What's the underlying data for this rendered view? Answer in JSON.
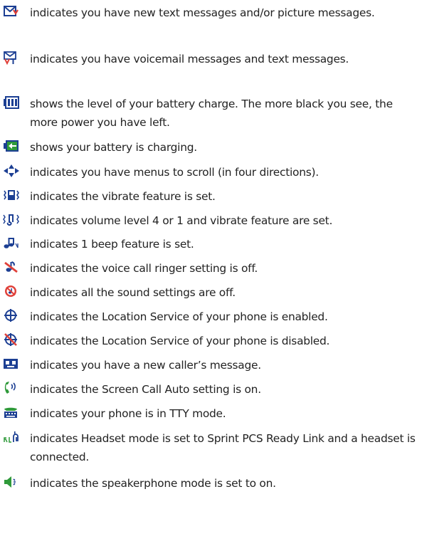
{
  "colors": {
    "text": "#222222",
    "icon_blue": "#1c3f93",
    "icon_red": "#e0413a",
    "icon_green": "#2f9a3a",
    "icon_black": "#111111"
  },
  "entries": [
    {
      "icon": "text-message-envelope-icon",
      "text": "indicates you have new text messages and/or picture messages."
    },
    {
      "icon": "voicemail-text-icon",
      "text": "indicates you have voicemail messages and text messages."
    },
    {
      "icon": "battery-level-icon",
      "text": "shows the level of your battery charge. The more black you see, the more power you have left."
    },
    {
      "icon": "battery-charging-icon",
      "text": "shows your battery is charging."
    },
    {
      "icon": "four-way-scroll-icon",
      "text": "indicates you have menus to scroll (in four directions)."
    },
    {
      "icon": "vibrate-icon",
      "text": "indicates the vibrate feature is set."
    },
    {
      "icon": "volume-vibrate-icon",
      "text": "indicates volume level 4 or 1 and vibrate feature are set."
    },
    {
      "icon": "one-beep-icon",
      "text": "indicates 1 beep feature is set."
    },
    {
      "icon": "ringer-off-icon",
      "text": "indicates the voice call ringer setting is off."
    },
    {
      "icon": "all-sounds-off-icon",
      "text": "indicates all the sound settings are off."
    },
    {
      "icon": "location-on-icon",
      "text": "indicates the Location Service of your phone is enabled."
    },
    {
      "icon": "location-off-icon",
      "text": "indicates the Location Service of your phone is disabled."
    },
    {
      "icon": "caller-message-icon",
      "text": "indicates you have a new caller’s message."
    },
    {
      "icon": "screen-call-auto-icon",
      "text": "indicates the Screen Call Auto setting is on."
    },
    {
      "icon": "tty-mode-icon",
      "text": "indicates your phone is in TTY mode."
    },
    {
      "icon": "ready-link-headset-icon",
      "text": "indicates Headset mode is set to Sprint PCS Ready Link and a headset is connected."
    },
    {
      "icon": "speakerphone-icon",
      "text": "indicates the speakerphone mode is set to on."
    }
  ]
}
